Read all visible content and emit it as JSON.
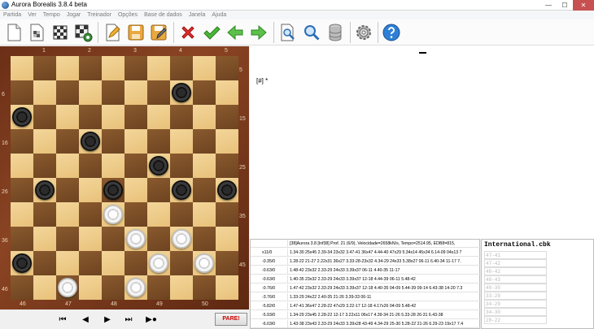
{
  "window": {
    "title": "Aurora Borealis 3.8.4 beta",
    "minimize": "—",
    "maximize": "☐",
    "close": "✕"
  },
  "menu": [
    "Partida",
    "Ver",
    "Tempo",
    "Jogar",
    "Treinador",
    "Opções",
    "Base de dados",
    "Janela",
    "Ajuda"
  ],
  "toolbar_icons": [
    "new-document-icon",
    "board-setup-icon",
    "board-icon",
    "board-gear-icon",
    "edit-icon",
    "save-icon",
    "save-edit-icon",
    "delete-icon",
    "accept-icon",
    "back-arrow-icon",
    "forward-arrow-icon",
    "magnify-document-icon",
    "search-icon",
    "database-icon",
    "settings-gear-icon",
    "help-icon"
  ],
  "board": {
    "top_labels": [
      "1",
      "2",
      "3",
      "4",
      "5"
    ],
    "right_labels": [
      "5",
      "15",
      "25",
      "35",
      "45"
    ],
    "left_labels": [
      "6",
      "16",
      "26",
      "36",
      "46"
    ],
    "bottom_labels": [
      "46",
      "47",
      "48",
      "49",
      "50"
    ],
    "rows": [
      "----------",
      "-------b--",
      "b---------",
      "---b------",
      "------b---",
      "-b--b--b-b",
      "----w-----",
      "-----w-w--",
      "b-----w-w-",
      "--w--w----"
    ]
  },
  "navigation": {
    "first": "⏮",
    "prev": "◀",
    "next": "▶",
    "last": "⏭",
    "record": "▶●",
    "stop_label": "PARE!"
  },
  "notation": {
    "tag": "[#] *"
  },
  "engine": {
    "header": "[38]Aurora 3.8 [Inf38]  Prof. 21 (6/9), Velocidade=2658kN/s,  Tempo=2514.95,  EDB8=815,",
    "lines": [
      {
        "score": "x11/0",
        "moves": "1.34-30 25x45 2.39-34 23x32 3.47-41 36x47 4.44-40 47x29 5.34x14 45x34 6.14-09 04x13 7"
      },
      {
        "score": "-0.35/0",
        "moves": "1.28-22 21-27 2.22x31 36x27 3.33-28-23x32 4.34-29 24x33 5.38x27 06-11 6.40-34 11-17 7."
      },
      {
        "score": "-0.63/0",
        "moves": "1.48-42 23x32 2.33-29 24x33 3.39x37 06-11 4.40-35 11-17"
      },
      {
        "score": "-0.63/0",
        "moves": "1.40-35 23x32 2.33-29 24x33 3.39x37 12-18 4.44-39 06-11 5.48-42"
      },
      {
        "score": "-0.76/0",
        "moves": "1.47-42 23x32 2.33-29 24x33 3.39x37 12-18 4.40-35 04-09 5.44-39 09-14 6.43-38 14-20 7.3"
      },
      {
        "score": "-3.76/0",
        "moves": "1.33-29 24x22 2.40-35 21-26 3.39-33 06-11"
      },
      {
        "score": "-5.82/0",
        "moves": "1.47-41 36x47 2.28-22 47x29 3.22-17 12-18 4.17x26 04-09 5.48-42"
      },
      {
        "score": "-5.93/0",
        "moves": "1.34-29 23x45 2.28-22 12-17 3.22x11 06x17 4.39-34 21-26 5.33-28 26-31 6.43-38"
      },
      {
        "score": "-6.03/0",
        "moves": "1.43-38 23x43 2.33-29 24x33 3.39x28 43-49 4.34-29 25-30 5.28-22 21-26 6.29-23 19x17 7.4"
      }
    ]
  },
  "database": {
    "title": "International.cbk",
    "rows": [
      "47-41",
      "47-42",
      "48-42",
      "48-43",
      "40-35",
      "33-29",
      "34-29",
      "34-30",
      "28-22"
    ]
  }
}
